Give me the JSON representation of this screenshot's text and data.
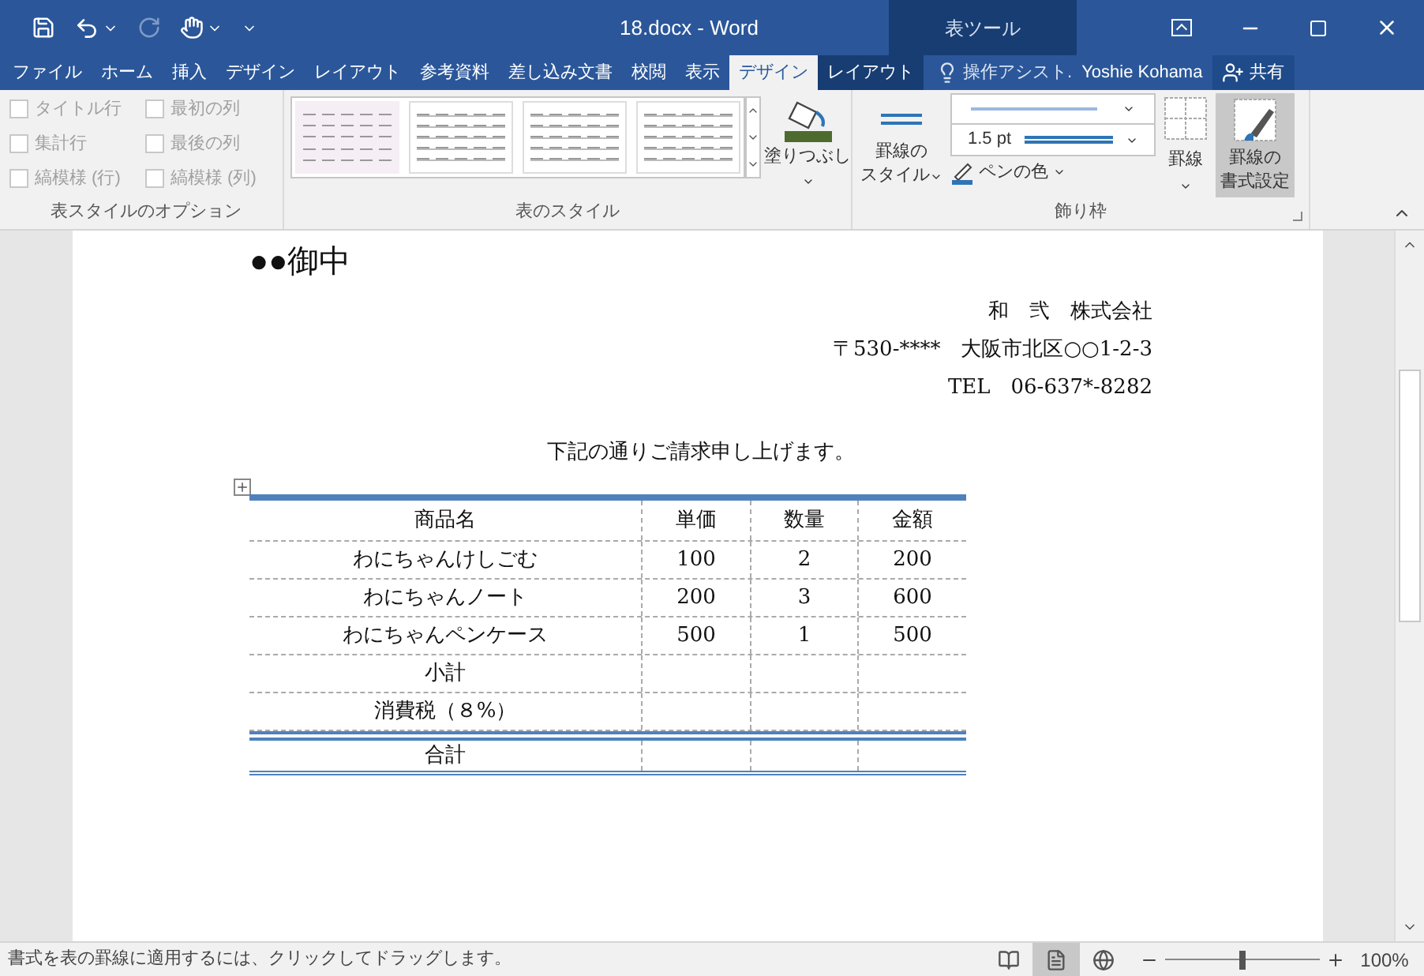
{
  "window": {
    "title": "18.docx - Word",
    "context_group": "表ツール"
  },
  "ribbon_tabs": [
    {
      "label": "ファイル",
      "selected": false,
      "contextual": false
    },
    {
      "label": "ホーム",
      "selected": false,
      "contextual": false
    },
    {
      "label": "挿入",
      "selected": false,
      "contextual": false
    },
    {
      "label": "デザイン",
      "selected": false,
      "contextual": false
    },
    {
      "label": "レイアウト",
      "selected": false,
      "contextual": false
    },
    {
      "label": "参考資料",
      "selected": false,
      "contextual": false
    },
    {
      "label": "差し込み文書",
      "selected": false,
      "contextual": false
    },
    {
      "label": "校閲",
      "selected": false,
      "contextual": false
    },
    {
      "label": "表示",
      "selected": false,
      "contextual": false
    },
    {
      "label": "デザイン",
      "selected": true,
      "contextual": true
    },
    {
      "label": "レイアウト",
      "selected": false,
      "contextual": true
    }
  ],
  "tell_me": "操作アシスト.",
  "user": "Yoshie Kohama",
  "share": "共有",
  "style_options": {
    "title": "表スタイルのオプション",
    "items": [
      {
        "label": "タイトル行",
        "checked": false,
        "disabled": true
      },
      {
        "label": "最初の列",
        "checked": false,
        "disabled": true
      },
      {
        "label": "集計行",
        "checked": false,
        "disabled": true
      },
      {
        "label": "最後の列",
        "checked": false,
        "disabled": true
      },
      {
        "label": "縞模様 (行)",
        "checked": false,
        "disabled": true
      },
      {
        "label": "縞模様 (列)",
        "checked": false,
        "disabled": true
      }
    ]
  },
  "table_styles": {
    "title": "表のスタイル",
    "shading": "塗りつぶし"
  },
  "borders": {
    "title": "飾り枠",
    "border_styles": [
      "罫線の",
      "スタイル"
    ],
    "pen_weight": "1.5 pt",
    "pen_color": "ペンの色",
    "borders_button": "罫線",
    "border_painter": [
      "罫線の",
      "書式設定"
    ],
    "border_painter_on": true
  },
  "document": {
    "addressee": "●●御中",
    "sender_lines": [
      "和　弐　株式会社",
      "〒530-****　大阪市北区○○1-2-3",
      "TEL　06-637*-8282"
    ],
    "intro": "下記の通りご請求申し上げます。",
    "table": {
      "columns": [
        "商品名",
        "単価",
        "数量",
        "金額"
      ],
      "rows": [
        {
          "kind": "item",
          "cells": [
            "わにちゃんけしごむ",
            "100",
            "2",
            "200"
          ]
        },
        {
          "kind": "item",
          "cells": [
            "わにちゃんノート",
            "200",
            "3",
            "600"
          ]
        },
        {
          "kind": "item",
          "cells": [
            "わにちゃんペンケース",
            "500",
            "1",
            "500"
          ]
        },
        {
          "kind": "summary",
          "cells": [
            "小計"
          ]
        },
        {
          "kind": "summary",
          "cells": [
            "消費税（８%）"
          ]
        },
        {
          "kind": "total",
          "cells": [
            "合計"
          ]
        }
      ]
    }
  },
  "status_bar": {
    "message": "書式を表の罫線に適用するには、クリックしてドラッグします。",
    "views": [
      {
        "kind": "read",
        "selected": false
      },
      {
        "kind": "print",
        "selected": true
      },
      {
        "kind": "web",
        "selected": false
      }
    ],
    "zoom": {
      "level": 0.5,
      "label": "100%"
    }
  }
}
